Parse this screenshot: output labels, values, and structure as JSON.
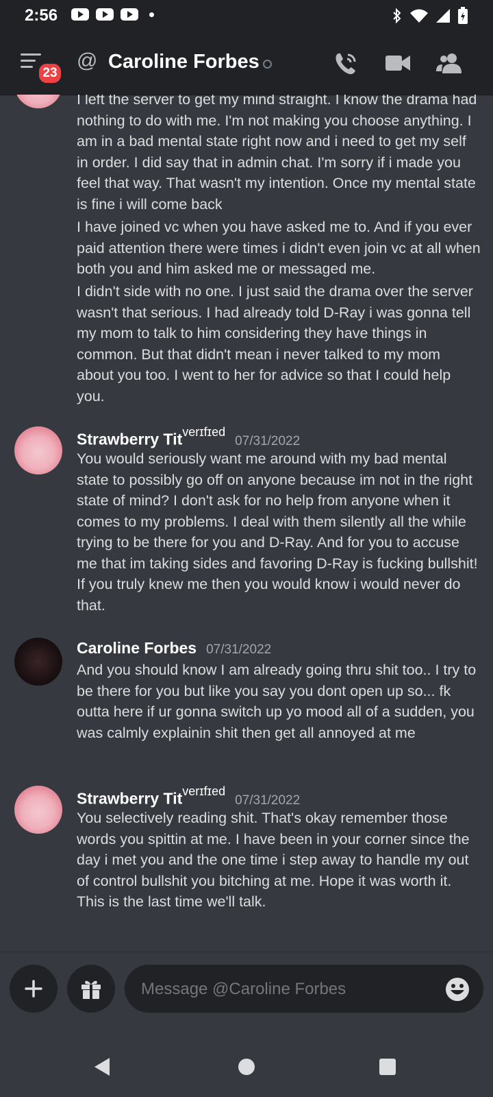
{
  "status_bar": {
    "time": "2:56"
  },
  "header": {
    "badge_count": "23",
    "at_symbol": "@",
    "title": "Caroline Forbes"
  },
  "messages": [
    {
      "continuation": true,
      "paragraphs": [
        "I left the server to get my mind straight. I know the drama had nothing to do with me. I'm not making you choose anything. I am in a bad mental state right now and i need to get my self in order. I did say that in admin chat. I'm sorry if i made you feel that way. That wasn't my intention. Once my mental state is fine i will come back",
        "I have joined vc when you have asked me to. And if you ever paid attention there were times i didn't even join vc at all when both you and him asked me or messaged me.",
        "I didn't side with no one. I just said the drama over the server wasn't that serious. I had already told D-Ray i was gonna tell my mom to talk to him considering they have things in common. But that didn't mean i never talked to my mom about you too. I went to her for advice so that I could help you."
      ]
    },
    {
      "author": "Strawberry  Tit",
      "author_suffix": "verɪfɪed",
      "timestamp": "07/31/2022",
      "text": "You would seriously want me around with my bad mental state to possibly go off on anyone because im not in the right state of mind? I don't ask for no help from anyone when it comes to my problems. I deal with them silently all the while trying to be there for you and D-Ray. And for you to accuse me that im taking sides and favoring D-Ray is fucking bullshit! If you truly knew me then you would know i would never do that."
    },
    {
      "author": "Caroline Forbes",
      "timestamp": "07/31/2022",
      "text": "And you should know I am already going thru shit too.. I try to be there for you but like you say you dont open up so... fk outta here if ur gonna switch up yo mood all of a sudden, you was calmly explainin shit then get all annoyed at me"
    },
    {
      "author": "Strawberry  Tit",
      "author_suffix": "verɪfɪed",
      "timestamp": "07/31/2022",
      "text": "You selectively reading shit. That's okay remember those words you spittin at me. I have been in your corner since the day i met you and the one time i step away to handle my out of control bullshit you bitching at me. Hope it was worth it. This is the last time we'll talk."
    }
  ],
  "composer": {
    "placeholder": "Message @Caroline Forbes"
  },
  "icons": {
    "status_bar": [
      "youtube-icon",
      "youtube-icon",
      "youtube-icon",
      "notification-dot-icon",
      "bluetooth-icon",
      "wifi-icon",
      "signal-icon",
      "battery-icon"
    ],
    "header": [
      "menu-icon",
      "at-icon",
      "voice-call-icon",
      "video-call-icon",
      "members-icon"
    ],
    "composer": [
      "plus-icon",
      "gift-icon",
      "emoji-icon"
    ],
    "nav": [
      "back-icon",
      "home-icon",
      "recents-icon"
    ]
  }
}
